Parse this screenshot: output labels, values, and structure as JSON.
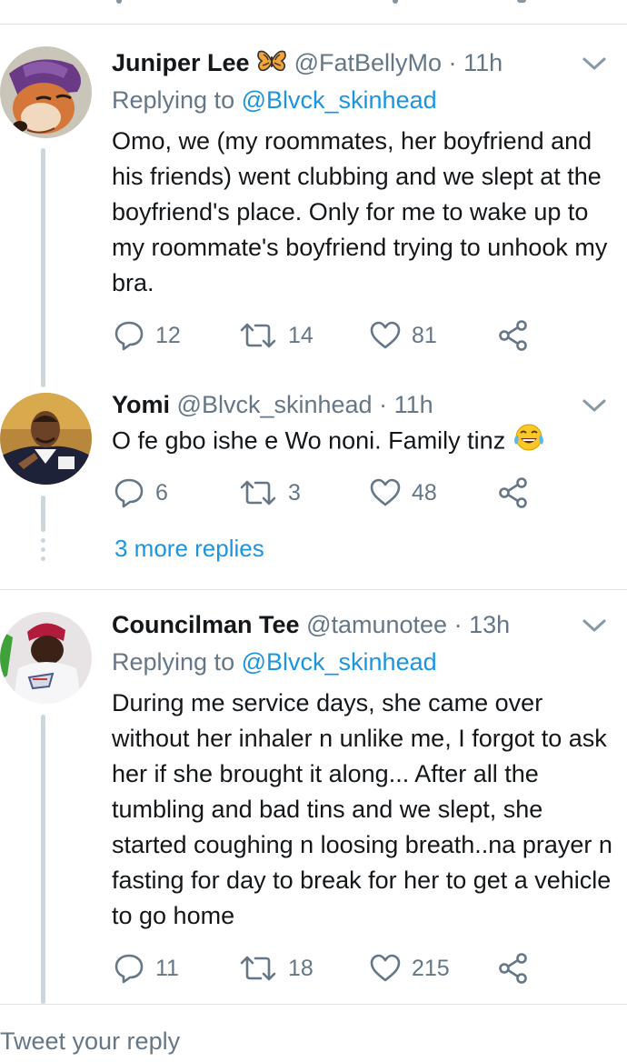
{
  "tweets": [
    {
      "name": "Juniper Lee",
      "emoji": "butterfly",
      "handle": "@FatBellyMo",
      "time": "11h",
      "reply_prefix": "Replying to",
      "reply_to": "@Blvck_skinhead",
      "text": "Omo, we (my roommates, her boyfriend and his friends) went clubbing and we slept at the boyfriend's place. Only for me to wake up to my roommate's boyfriend trying to unhook my bra.",
      "replies": "12",
      "retweets": "14",
      "likes": "81"
    },
    {
      "name": "Yomi",
      "handle": "@Blvck_skinhead",
      "time": "11h",
      "text": "O fe gbo ishe e Wo noni. Family tinz",
      "emoji": "laughing-tears",
      "replies": "6",
      "retweets": "3",
      "likes": "48"
    },
    {
      "name": "Councilman Tee",
      "handle": "@tamunotee",
      "time": "13h",
      "reply_prefix": "Replying to",
      "reply_to": "@Blvck_skinhead",
      "text": "During me service days, she came over without her inhaler n unlike me, I forgot to ask her if she brought it along... After all the tumbling and bad tins and we slept, she started coughing n loosing breath..na prayer n fasting for day to break for her to get a vehicle to go home",
      "replies": "11",
      "retweets": "18",
      "likes": "215"
    }
  ],
  "more_replies": "3 more replies",
  "compose_placeholder": "Tweet your reply",
  "separator_dot": "·",
  "colors": {
    "accent": "#1b95e0",
    "secondary_text": "#657786",
    "primary_text": "#14171a",
    "divider": "#dfe3e6"
  },
  "icons": [
    "reply-icon",
    "retweet-icon",
    "like-icon",
    "share-icon",
    "chevron-down-icon"
  ]
}
